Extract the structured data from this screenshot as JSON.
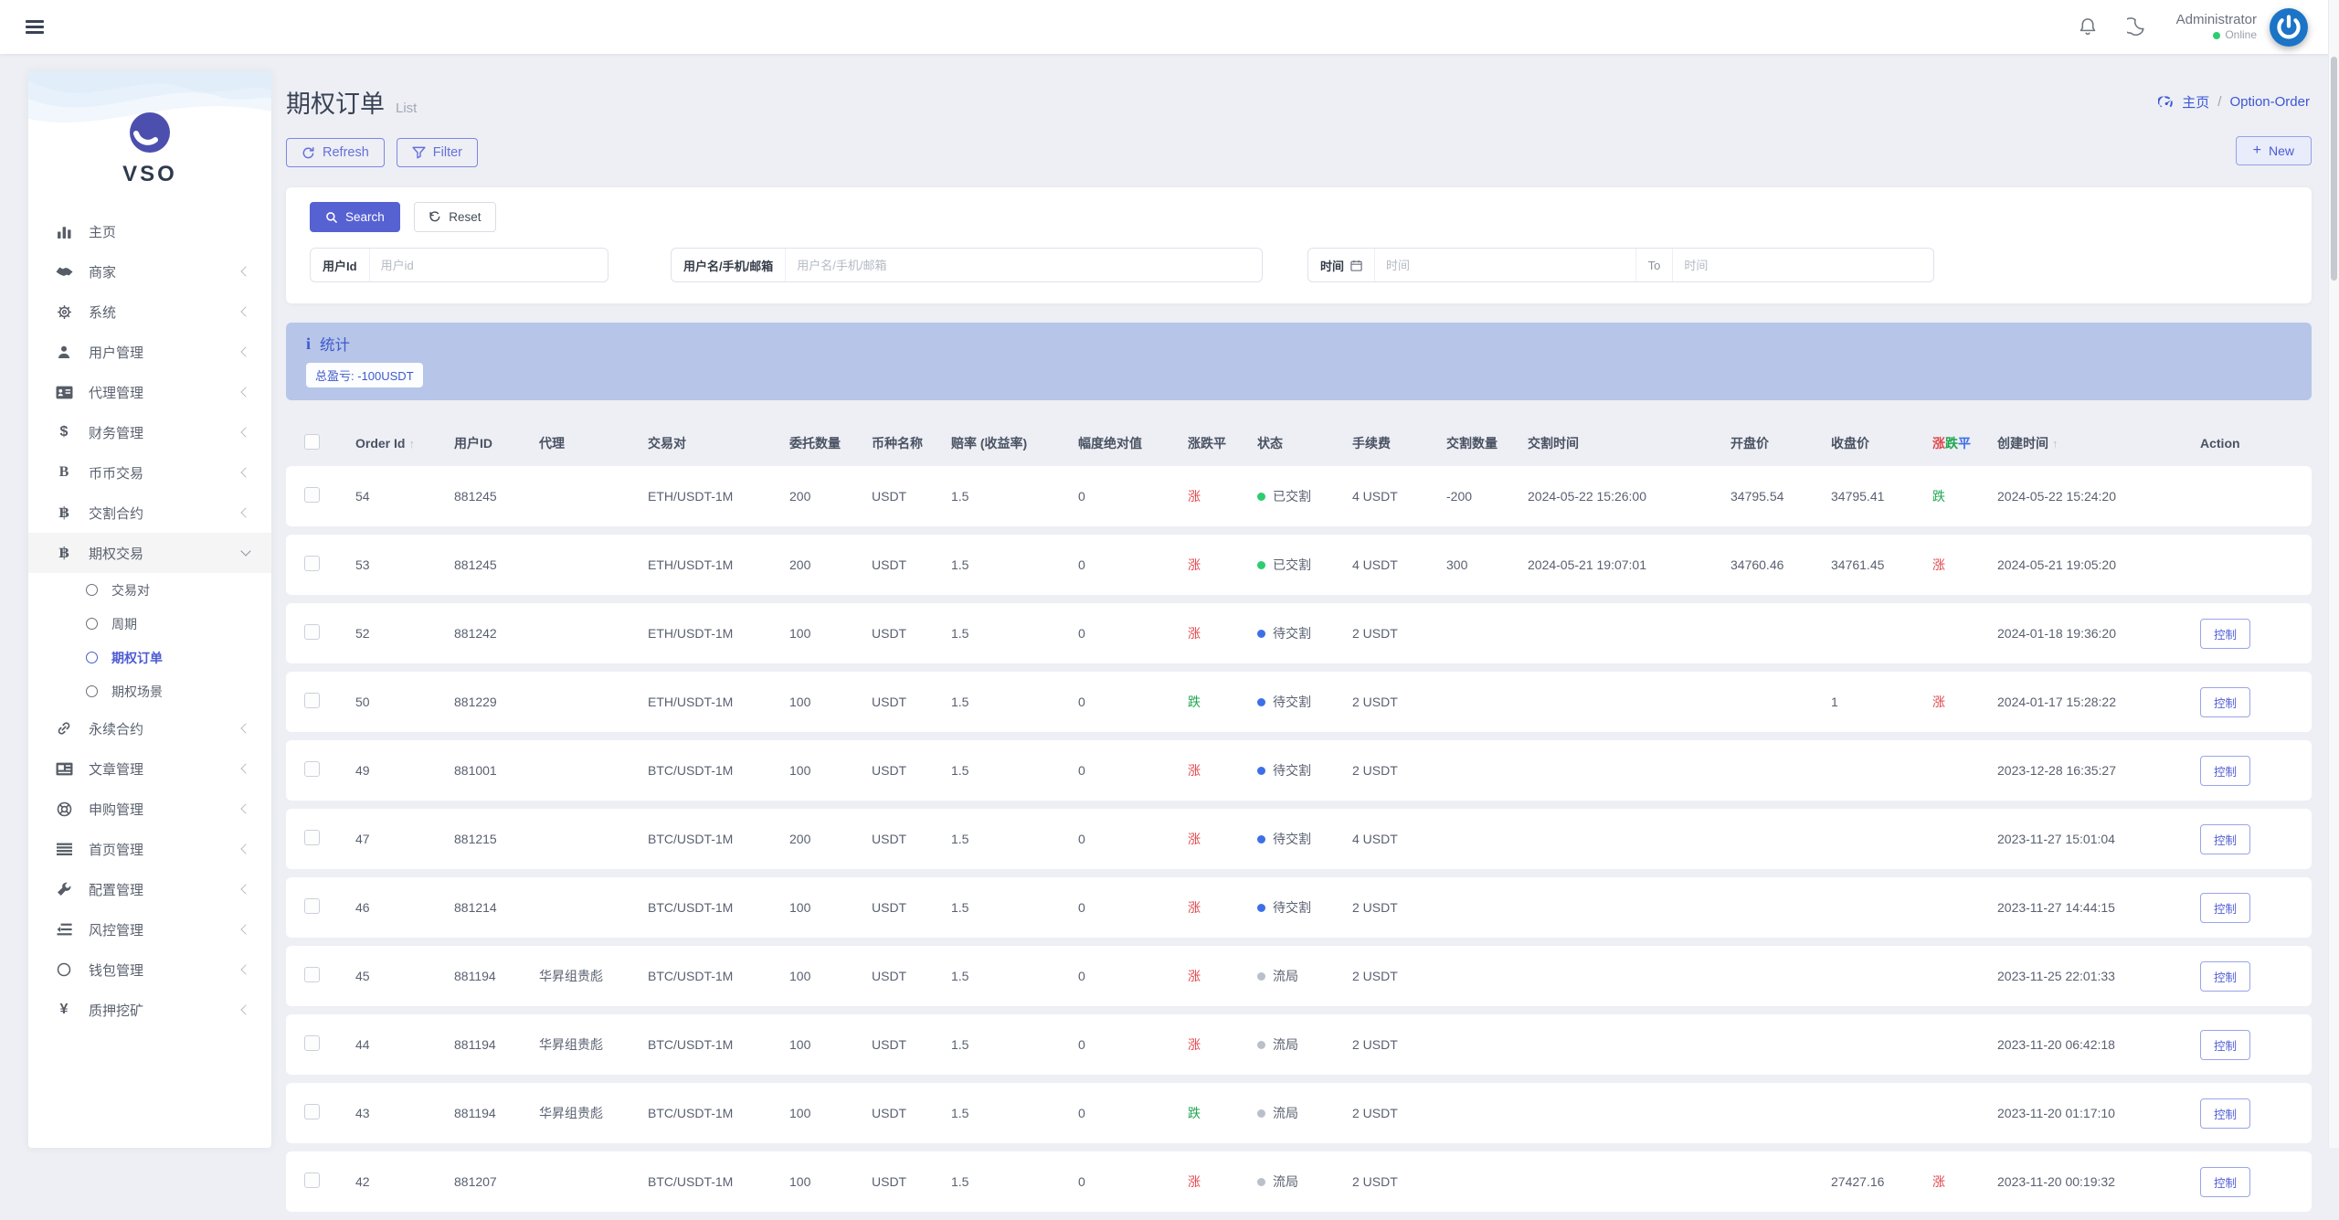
{
  "header": {
    "user_name": "Administrator",
    "user_status": "Online"
  },
  "sidebar": {
    "logo": "VSO",
    "items": [
      {
        "label": "主页",
        "icon": "bar-chart",
        "has_children": false
      },
      {
        "label": "商家",
        "icon": "handshake",
        "has_children": true
      },
      {
        "label": "系统",
        "icon": "gear",
        "has_children": true
      },
      {
        "label": "用户管理",
        "icon": "user",
        "has_children": true
      },
      {
        "label": "代理管理",
        "icon": "id-card",
        "has_children": true
      },
      {
        "label": "财务管理",
        "icon": "dollar",
        "has_children": true
      },
      {
        "label": "币币交易",
        "icon": "letter-b",
        "has_children": true
      },
      {
        "label": "交割合约",
        "icon": "bitcoin",
        "has_children": true
      },
      {
        "label": "期权交易",
        "icon": "bitcoin",
        "has_children": true,
        "expanded": true,
        "children": [
          {
            "label": "交易对"
          },
          {
            "label": "周期"
          },
          {
            "label": "期权订单",
            "active": true
          },
          {
            "label": "期权场景"
          }
        ]
      },
      {
        "label": "永续合约",
        "icon": "link",
        "has_children": true
      },
      {
        "label": "文章管理",
        "icon": "newspaper",
        "has_children": true
      },
      {
        "label": "申购管理",
        "icon": "life-ring",
        "has_children": true
      },
      {
        "label": "首页管理",
        "icon": "list",
        "has_children": true
      },
      {
        "label": "配置管理",
        "icon": "wrench",
        "has_children": true
      },
      {
        "label": "风控管理",
        "icon": "indent-list",
        "has_children": true
      },
      {
        "label": "钱包管理",
        "icon": "circle",
        "has_children": true
      },
      {
        "label": "质押挖矿",
        "icon": "yen",
        "has_children": true
      }
    ]
  },
  "page": {
    "title": "期权订单",
    "subtitle": "List",
    "breadcrumb": {
      "home": "主页",
      "separator": "/",
      "current": "Option-Order"
    },
    "toolbar": {
      "refresh_label": "Refresh",
      "filter_label": "Filter",
      "new_label": "New"
    }
  },
  "search": {
    "search_label": "Search",
    "reset_label": "Reset",
    "fields": {
      "user_id": {
        "label": "用户Id",
        "placeholder": "用户id"
      },
      "user_query": {
        "label": "用户名/手机/邮箱",
        "placeholder": "用户名/手机/邮箱"
      },
      "time": {
        "label": "时间",
        "placeholder_from": "时间",
        "separator": "To",
        "placeholder_to": "时间"
      }
    }
  },
  "stats": {
    "title": "统计",
    "badge": "总盈亏: -100USDT"
  },
  "table": {
    "columns": [
      {
        "label": "Order Id",
        "sorted": true
      },
      {
        "label": "用户ID"
      },
      {
        "label": "代理"
      },
      {
        "label": "交易对"
      },
      {
        "label": "委托数量"
      },
      {
        "label": "币种名称"
      },
      {
        "label": "赔率 (收益率)"
      },
      {
        "label": "幅度绝对值"
      },
      {
        "label": "涨跌平"
      },
      {
        "label": "状态"
      },
      {
        "label": "手续费"
      },
      {
        "label": "交割数量"
      },
      {
        "label": "交割时间"
      },
      {
        "label": "开盘价"
      },
      {
        "label": "收盘价"
      },
      {
        "label": "涨跌平",
        "colored": true
      },
      {
        "label": "创建时间",
        "sorted": true
      },
      {
        "label": "Action"
      }
    ],
    "rows": [
      {
        "order_id": "54",
        "user_id": "881245",
        "agent": "",
        "pair": "ETH/USDT-1M",
        "amount": "200",
        "coin": "USDT",
        "odds": "1.5",
        "amplitude": "0",
        "direction": "涨",
        "status": "已交割",
        "fee": "4 USDT",
        "settle_qty": "-200",
        "settle_time": "2024-05-22 15:26:00",
        "open_price": "34795.54",
        "close_price": "34795.41",
        "result": "跌",
        "created": "2024-05-22 15:24:20",
        "action": ""
      },
      {
        "order_id": "53",
        "user_id": "881245",
        "agent": "",
        "pair": "ETH/USDT-1M",
        "amount": "200",
        "coin": "USDT",
        "odds": "1.5",
        "amplitude": "0",
        "direction": "涨",
        "status": "已交割",
        "fee": "4 USDT",
        "settle_qty": "300",
        "settle_time": "2024-05-21 19:07:01",
        "open_price": "34760.46",
        "close_price": "34761.45",
        "result": "涨",
        "created": "2024-05-21 19:05:20",
        "action": ""
      },
      {
        "order_id": "52",
        "user_id": "881242",
        "agent": "",
        "pair": "ETH/USDT-1M",
        "amount": "100",
        "coin": "USDT",
        "odds": "1.5",
        "amplitude": "0",
        "direction": "涨",
        "status": "待交割",
        "fee": "2 USDT",
        "settle_qty": "",
        "settle_time": "",
        "open_price": "",
        "close_price": "",
        "result": "",
        "created": "2024-01-18 19:36:20",
        "action": "控制"
      },
      {
        "order_id": "50",
        "user_id": "881229",
        "agent": "",
        "pair": "ETH/USDT-1M",
        "amount": "100",
        "coin": "USDT",
        "odds": "1.5",
        "amplitude": "0",
        "direction": "跌",
        "status": "待交割",
        "fee": "2 USDT",
        "settle_qty": "",
        "settle_time": "",
        "open_price": "",
        "close_price": "1",
        "result": "涨",
        "created": "2024-01-17 15:28:22",
        "action": "控制"
      },
      {
        "order_id": "49",
        "user_id": "881001",
        "agent": "",
        "pair": "BTC/USDT-1M",
        "amount": "100",
        "coin": "USDT",
        "odds": "1.5",
        "amplitude": "0",
        "direction": "涨",
        "status": "待交割",
        "fee": "2 USDT",
        "settle_qty": "",
        "settle_time": "",
        "open_price": "",
        "close_price": "",
        "result": "",
        "created": "2023-12-28 16:35:27",
        "action": "控制"
      },
      {
        "order_id": "47",
        "user_id": "881215",
        "agent": "",
        "pair": "BTC/USDT-1M",
        "amount": "200",
        "coin": "USDT",
        "odds": "1.5",
        "amplitude": "0",
        "direction": "涨",
        "status": "待交割",
        "fee": "4 USDT",
        "settle_qty": "",
        "settle_time": "",
        "open_price": "",
        "close_price": "",
        "result": "",
        "created": "2023-11-27 15:01:04",
        "action": "控制"
      },
      {
        "order_id": "46",
        "user_id": "881214",
        "agent": "",
        "pair": "BTC/USDT-1M",
        "amount": "100",
        "coin": "USDT",
        "odds": "1.5",
        "amplitude": "0",
        "direction": "涨",
        "status": "待交割",
        "fee": "2 USDT",
        "settle_qty": "",
        "settle_time": "",
        "open_price": "",
        "close_price": "",
        "result": "",
        "created": "2023-11-27 14:44:15",
        "action": "控制"
      },
      {
        "order_id": "45",
        "user_id": "881194",
        "agent": "华昇组贵彪",
        "pair": "BTC/USDT-1M",
        "amount": "100",
        "coin": "USDT",
        "odds": "1.5",
        "amplitude": "0",
        "direction": "涨",
        "status": "流局",
        "fee": "2 USDT",
        "settle_qty": "",
        "settle_time": "",
        "open_price": "",
        "close_price": "",
        "result": "",
        "created": "2023-11-25 22:01:33",
        "action": "控制"
      },
      {
        "order_id": "44",
        "user_id": "881194",
        "agent": "华昇组贵彪",
        "pair": "BTC/USDT-1M",
        "amount": "100",
        "coin": "USDT",
        "odds": "1.5",
        "amplitude": "0",
        "direction": "涨",
        "status": "流局",
        "fee": "2 USDT",
        "settle_qty": "",
        "settle_time": "",
        "open_price": "",
        "close_price": "",
        "result": "",
        "created": "2023-11-20 06:42:18",
        "action": "控制"
      },
      {
        "order_id": "43",
        "user_id": "881194",
        "agent": "华昇组贵彪",
        "pair": "BTC/USDT-1M",
        "amount": "100",
        "coin": "USDT",
        "odds": "1.5",
        "amplitude": "0",
        "direction": "跌",
        "status": "流局",
        "fee": "2 USDT",
        "settle_qty": "",
        "settle_time": "",
        "open_price": "",
        "close_price": "",
        "result": "",
        "created": "2023-11-20 01:17:10",
        "action": "控制"
      },
      {
        "order_id": "42",
        "user_id": "881207",
        "agent": "",
        "pair": "BTC/USDT-1M",
        "amount": "100",
        "coin": "USDT",
        "odds": "1.5",
        "amplitude": "0",
        "direction": "涨",
        "status": "流局",
        "fee": "2 USDT",
        "settle_qty": "",
        "settle_time": "",
        "open_price": "",
        "close_price": "27427.16",
        "result": "涨",
        "created": "2023-11-20 00:19:32",
        "action": "控制"
      }
    ]
  },
  "colors": {
    "accent": "#5661d2",
    "link_blue": "#3d56d4",
    "up": "#e0474c",
    "down": "#1ea64e",
    "flat": "#3d6fe8",
    "status": {
      "已交割": "#2ecc71",
      "待交割": "#3d6fe8",
      "流局": "#b9c0ca"
    },
    "stats_bg": "#b7c5e9",
    "online": "#2ecc71"
  }
}
